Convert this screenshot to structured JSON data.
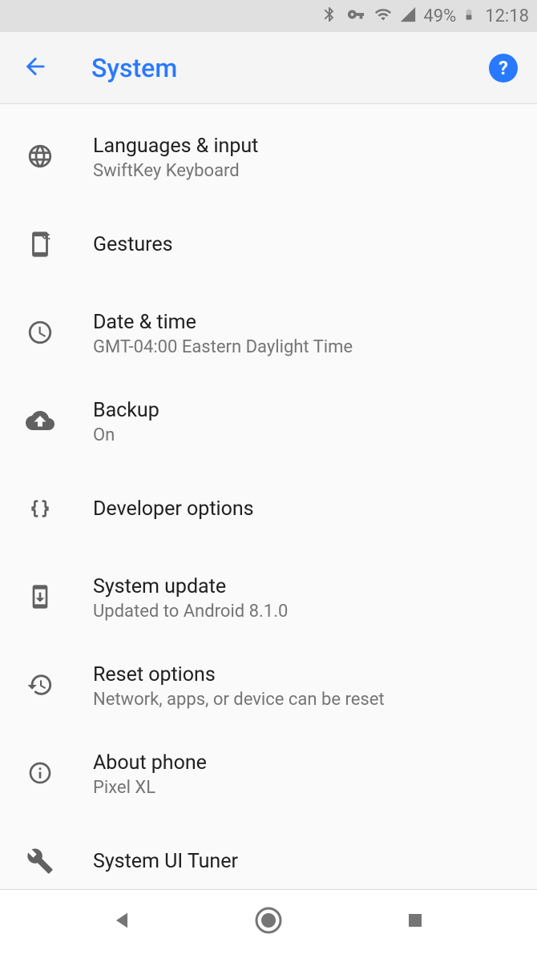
{
  "status": {
    "battery_percent": "49%",
    "time": "12:18"
  },
  "header": {
    "title": "System"
  },
  "items": [
    {
      "id": "languages",
      "title": "Languages & input",
      "subtitle": "SwiftKey Keyboard"
    },
    {
      "id": "gestures",
      "title": "Gestures",
      "subtitle": ""
    },
    {
      "id": "datetime",
      "title": "Date & time",
      "subtitle": "GMT-04:00 Eastern Daylight Time"
    },
    {
      "id": "backup",
      "title": "Backup",
      "subtitle": "On"
    },
    {
      "id": "developer",
      "title": "Developer options",
      "subtitle": ""
    },
    {
      "id": "update",
      "title": "System update",
      "subtitle": "Updated to Android 8.1.0"
    },
    {
      "id": "reset",
      "title": "Reset options",
      "subtitle": "Network, apps, or device can be reset"
    },
    {
      "id": "about",
      "title": "About phone",
      "subtitle": "Pixel XL"
    },
    {
      "id": "tuner",
      "title": "System UI Tuner",
      "subtitle": ""
    }
  ]
}
